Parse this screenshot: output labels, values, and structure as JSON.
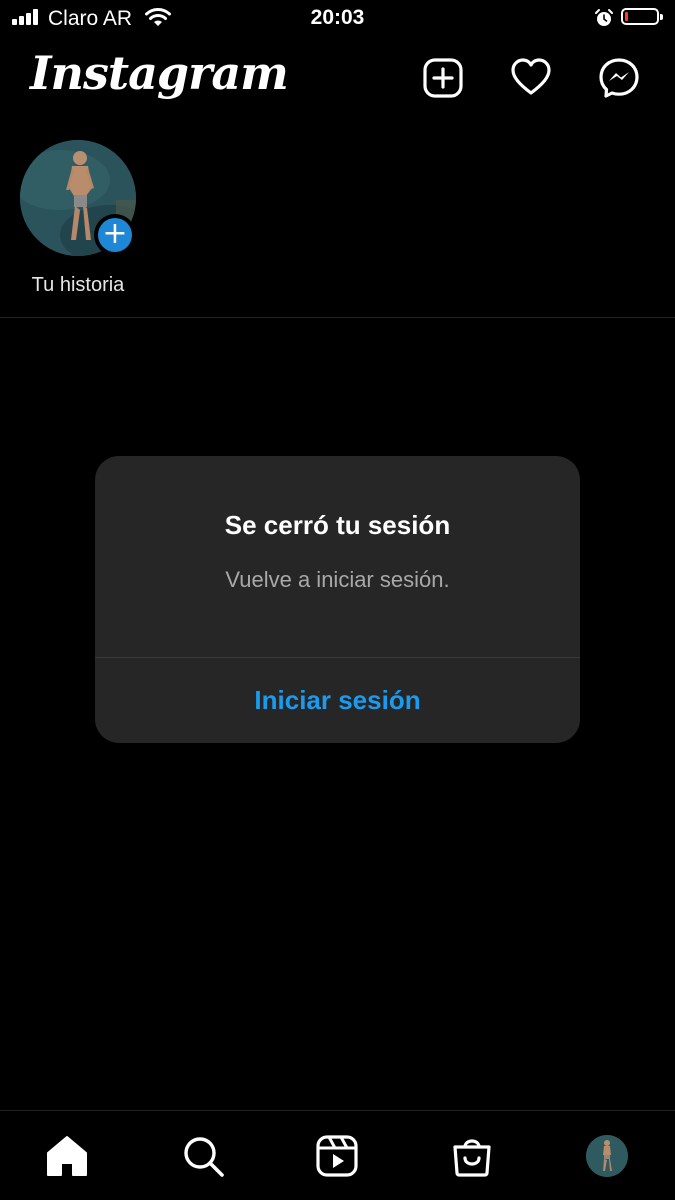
{
  "status_bar": {
    "carrier": "Claro AR",
    "time": "20:03",
    "battery_level": 0.1,
    "battery_color": "#ff3b30"
  },
  "header": {
    "logo": "Instagram",
    "icons": [
      "new-post-icon",
      "heart-icon",
      "messenger-icon"
    ]
  },
  "stories": {
    "own_story_label": "Tu historia",
    "add_badge": "+"
  },
  "alert": {
    "title": "Se cerró tu sesión",
    "message": "Vuelve a iniciar sesión.",
    "button_label": "Iniciar sesión",
    "button_color": "#1a9bef"
  },
  "tab_bar": {
    "tabs": [
      "home-icon",
      "search-icon",
      "reels-icon",
      "shop-icon",
      "profile-avatar"
    ]
  }
}
